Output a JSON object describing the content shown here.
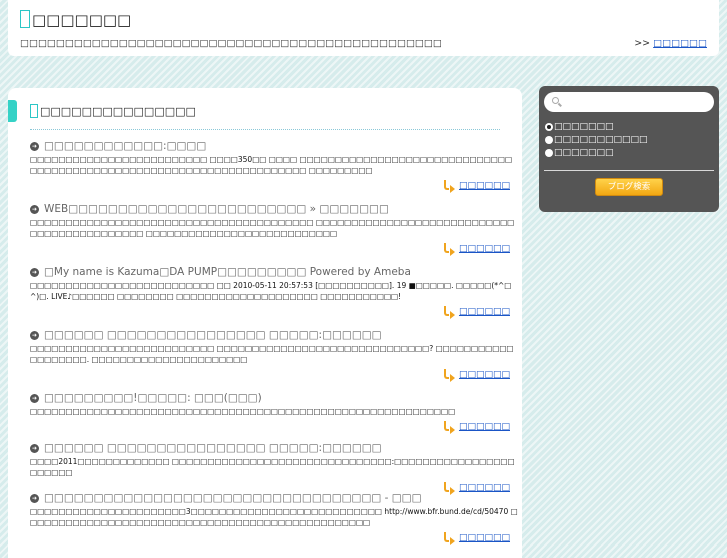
{
  "header": {
    "title": "□□□□□□□",
    "description": "□□□□□□□□□□□□□□□□□□□□□□□□□□□□□□□□□□□□□□□□□□□□□□□",
    "link_prefix": ">>",
    "link_label": "□□□□□□"
  },
  "main": {
    "title": "□□□□□□□□□□□□□□□",
    "more_label": "□□□□□□",
    "entries": [
      {
        "title": "□□□□□□□□□□□□:□□□□",
        "body": "□□□□□□□□□□□□□□□□□□□□□□□□□ □□□□350□□ □□□□ □□□□□□□□□□□□□□□□□□□□□□□□□□□□□□□□□□□□□□□□□□□□□□□□□□□□□□□□□□□□□□□□□□□□□ □□□□□□□□□"
      },
      {
        "title": "WEB□□□□□□□□□□□□□□□□□□□□□□□□ » □□□□□□□",
        "body": "□□□□□□□□□□□□□□□□□□□□□□□□□□□□□□□□□□□□□□□□ □□□□□□□□□□□□□□□□□□□□□□□□□□□□□□□□□□□□□□□□□□□□ □□□□□□□□□□□□□□□□□□□□□□□□□□□"
      },
      {
        "title": "□My name is Kazuma□DA PUMP□□□□□□□□□ Powered by Ameba",
        "body": "□□□□□□□□□□□□□□□□□□□□□□□□□□ □□ 2010-05-11 20:57:53 [□□□□□□□□□□]. 19 ■□□□□□. □□□□□(*^□^)□. LIVE♪□□□□□□ □□□□□□□□ □□□□□□□□□□□□□□□□□□□□ □□□□□□□□□□□!"
      },
      {
        "title": "□□□□□□ □□□□□□□□□□□□□□□□ □□□□□:□□□□□□",
        "body": "□□□□□□□□□□□□□□□□□□□□□□□□□□ □□□□□□□□□□□□□□□□□□□□□□□□□□□□□□? □□□□□□□□□□□□□□□□□□□. □□□□□□□□□□□□□□□□□□□□□□"
      },
      {
        "title": "□□□□□□□□□!□□□□□: □□□(□□□)",
        "body": "□□□□□□□□□□□□□□□□□□□□□□□□□□□□□□□□□□□□□□□□□□□□□□□□□□□□□□□□□□□□"
      },
      {
        "title": "□□□□□□ □□□□□□□□□□□□□□□□ □□□□□:□□□□□□",
        "body": "□□□□2011□□□□□□□□□□□□□ □□□□□□□□□□□□□□□□□□□□□□□□□□□□□□□:□□□□□□□□□□□□□□□□□□□□□□□"
      },
      {
        "title": "□□□□□□□□□□□□□□□□□□□□□□□□□□□□□□□□□□ - □□□",
        "body": "□□□□□□□□□□□□□□□□□□□□□□3□□□□□□□□□□□□□□□□□□□□□□□□□□□ http://www.bfr.bund.de/cd/50470 □□□□□□□□□□□□□□□□□□□□□□□□□□□□□□□□□□□□□□□□□□□□□□□□□"
      }
    ]
  },
  "sidebar": {
    "search_placeholder": "",
    "options": [
      "□□□□□□□",
      "□□□□□□□□□□□",
      "□□□□□□□"
    ],
    "selected_option": 0,
    "search_button_label": "ブログ検索"
  },
  "colors": {
    "accent": "#35d2c6",
    "link": "#1a55c6",
    "sidebar_bg": "#555555",
    "button": "#f2a712"
  }
}
